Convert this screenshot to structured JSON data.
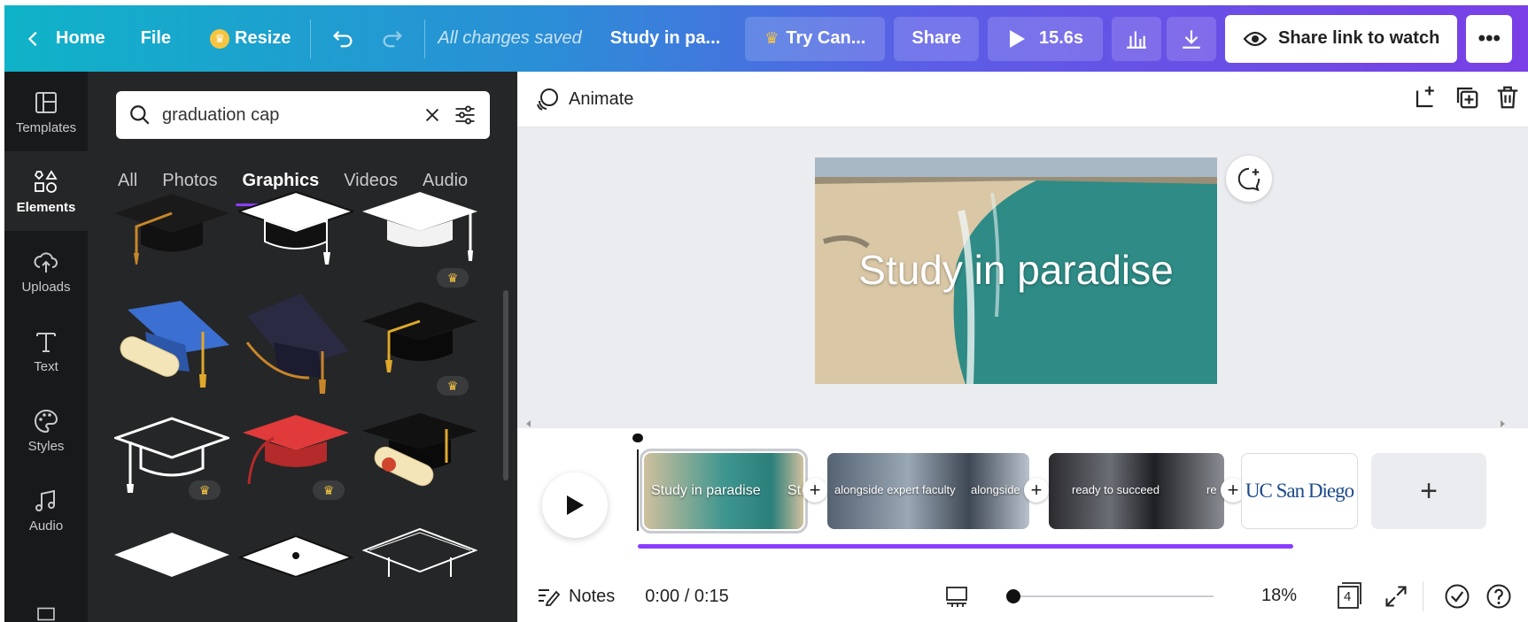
{
  "topbar": {
    "home_label": "Home",
    "file_label": "File",
    "resize_label": "Resize",
    "saved_status": "All changes saved",
    "design_title": "Study in pa...",
    "try_label": "Try Can...",
    "share_label": "Share",
    "play_duration": "15.6s",
    "share_link_label": "Share link to watch",
    "more_label": "•••"
  },
  "rail": {
    "items": [
      {
        "label": "Templates"
      },
      {
        "label": "Elements"
      },
      {
        "label": "Uploads"
      },
      {
        "label": "Text"
      },
      {
        "label": "Styles"
      },
      {
        "label": "Audio"
      }
    ]
  },
  "panel": {
    "search_value": "graduation cap",
    "tabs": [
      "All",
      "Photos",
      "Graphics",
      "Videos",
      "Audio"
    ],
    "active_tab": "Graphics",
    "premium_mark": "♛"
  },
  "canvas": {
    "animate_label": "Animate",
    "slide_title": "Study in paradise"
  },
  "timeline": {
    "clips": [
      {
        "label": "Study in paradise",
        "tail": "St"
      },
      {
        "label": "alongside expert faculty",
        "tail": "alongside"
      },
      {
        "label": "ready to succeed",
        "tail": "re"
      },
      {
        "label": "UC San Diego"
      }
    ],
    "add_label": "+",
    "progress": 0.87
  },
  "bottombar": {
    "notes_label": "Notes",
    "time_readout": "0:00 / 0:15",
    "zoom": "18%",
    "page_count": "4",
    "zoom_level": 0.18
  },
  "colors": {
    "accent": "#8b3dff",
    "panel_bg": "#252627",
    "rail_bg": "#18191b",
    "premium": "#f5c542"
  }
}
